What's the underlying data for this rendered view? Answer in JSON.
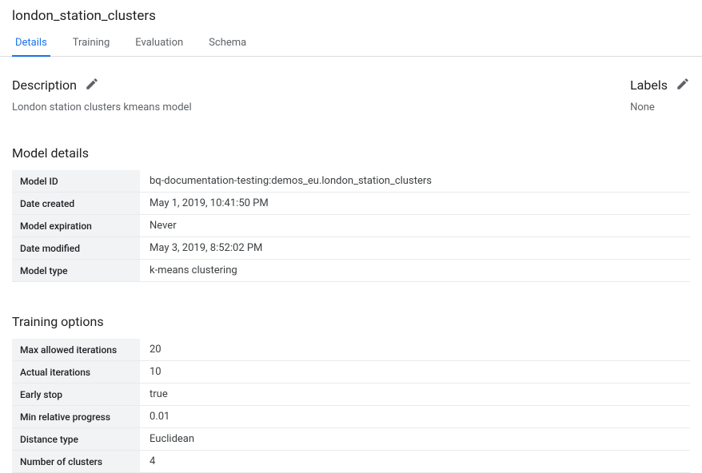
{
  "title": "london_station_clusters",
  "tabs": [
    {
      "label": "Details",
      "active": true
    },
    {
      "label": "Training",
      "active": false
    },
    {
      "label": "Evaluation",
      "active": false
    },
    {
      "label": "Schema",
      "active": false
    }
  ],
  "description": {
    "heading": "Description",
    "text": "London station clusters kmeans model"
  },
  "labels": {
    "heading": "Labels",
    "text": "None"
  },
  "model_details": {
    "heading": "Model details",
    "rows": [
      {
        "key": "Model ID",
        "value": "bq-documentation-testing:demos_eu.london_station_clusters"
      },
      {
        "key": "Date created",
        "value": "May 1, 2019, 10:41:50 PM"
      },
      {
        "key": "Model expiration",
        "value": "Never"
      },
      {
        "key": "Date modified",
        "value": "May 3, 2019, 8:52:02 PM"
      },
      {
        "key": "Model type",
        "value": "k-means clustering"
      }
    ]
  },
  "training_options": {
    "heading": "Training options",
    "rows": [
      {
        "key": "Max allowed iterations",
        "value": "20"
      },
      {
        "key": "Actual iterations",
        "value": "10"
      },
      {
        "key": "Early stop",
        "value": "true"
      },
      {
        "key": "Min relative progress",
        "value": "0.01"
      },
      {
        "key": "Distance type",
        "value": "Euclidean"
      },
      {
        "key": "Number of clusters",
        "value": "4"
      }
    ]
  }
}
